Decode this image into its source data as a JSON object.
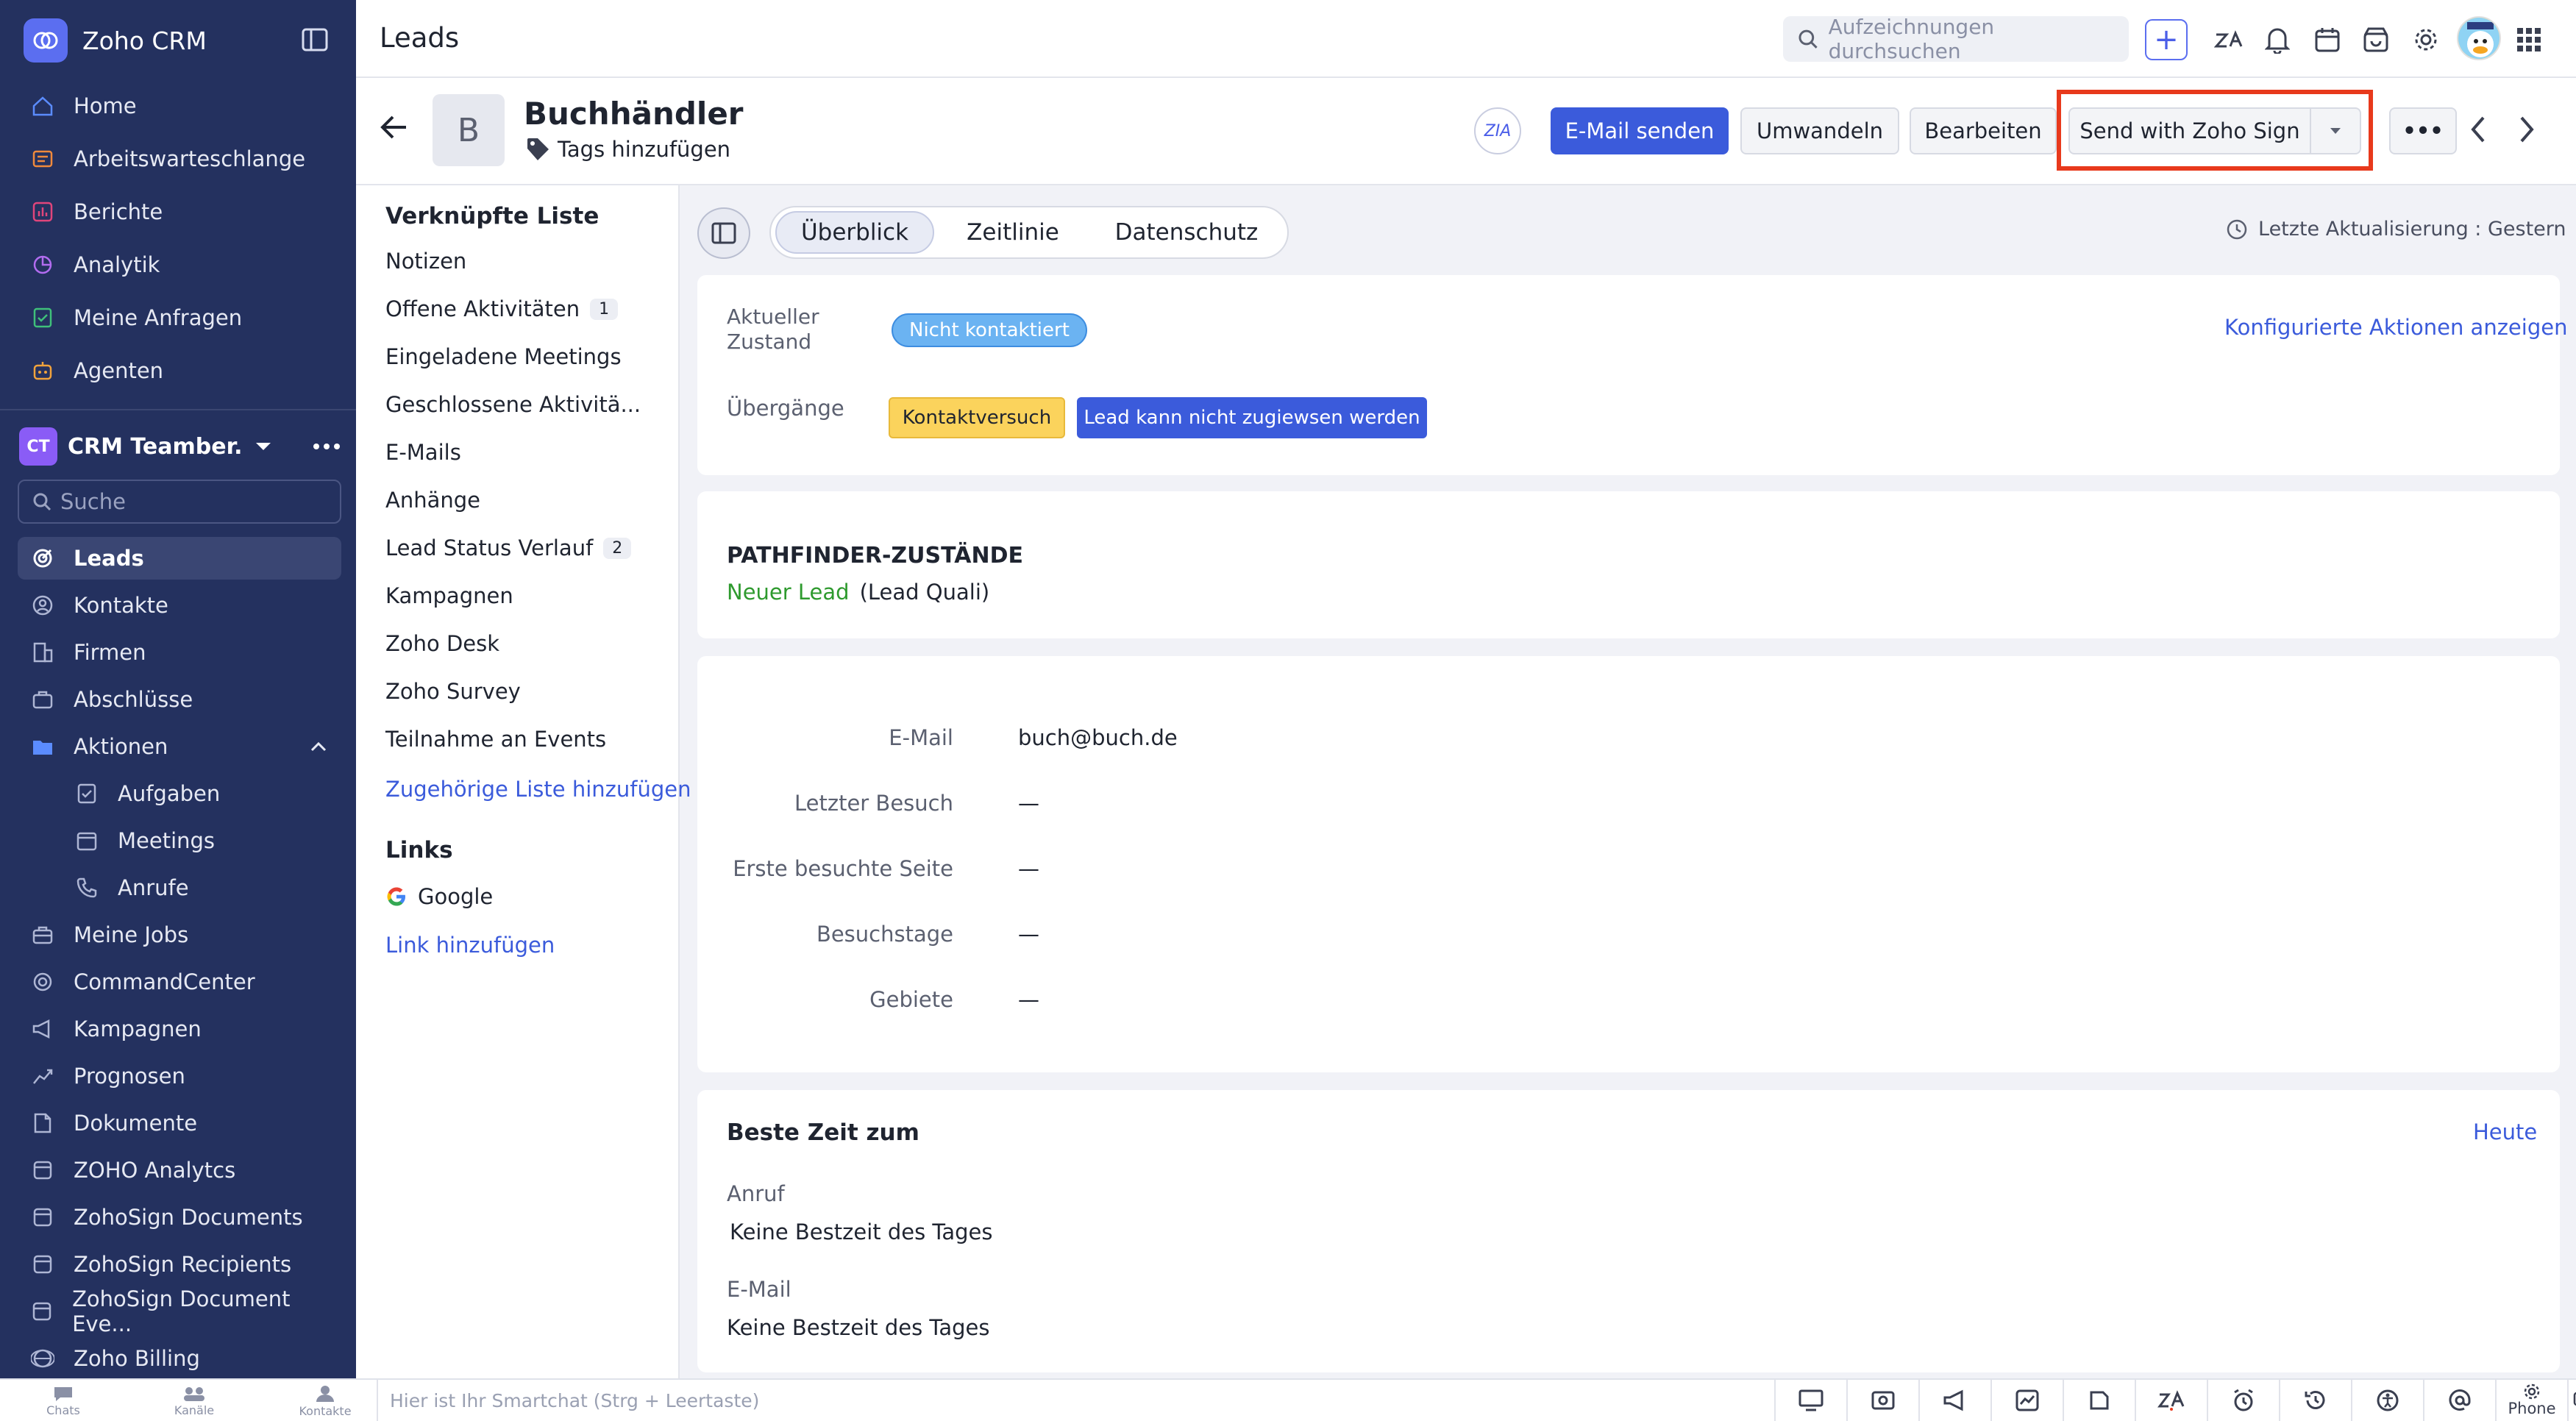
{
  "app": {
    "name": "Zoho CRM",
    "brand_color": "#5b6ef0",
    "sidebar_color": "#24315f"
  },
  "sidebar": {
    "top_items": [
      {
        "label": "Home",
        "icon": "home-icon"
      },
      {
        "label": "Arbeitswarteschlange",
        "icon": "queue-icon"
      },
      {
        "label": "Berichte",
        "icon": "reports-icon"
      },
      {
        "label": "Analytik",
        "icon": "analytics-icon"
      },
      {
        "label": "Meine Anfragen",
        "icon": "requests-icon"
      },
      {
        "label": "Agenten",
        "icon": "agent-icon"
      }
    ],
    "workspace": {
      "badge": "CT",
      "name": "CRM Teamber..."
    },
    "search_placeholder": "Suche",
    "modules": [
      {
        "label": "Leads",
        "icon": "leads-icon",
        "active": true
      },
      {
        "label": "Kontakte",
        "icon": "contacts-icon"
      },
      {
        "label": "Firmen",
        "icon": "accounts-icon"
      },
      {
        "label": "Abschlüsse",
        "icon": "deals-icon"
      },
      {
        "label": "Aktionen",
        "icon": "folder-icon",
        "expanded": true
      },
      {
        "label": "Aufgaben",
        "icon": "tasks-icon",
        "sub": true
      },
      {
        "label": "Meetings",
        "icon": "meetings-icon",
        "sub": true
      },
      {
        "label": "Anrufe",
        "icon": "calls-icon",
        "sub": true
      },
      {
        "label": "Meine Jobs",
        "icon": "jobs-icon"
      },
      {
        "label": "CommandCenter",
        "icon": "commandcenter-icon"
      },
      {
        "label": "Kampagnen",
        "icon": "campaigns-icon"
      },
      {
        "label": "Prognosen",
        "icon": "forecasts-icon"
      },
      {
        "label": "Dokumente",
        "icon": "documents-icon"
      },
      {
        "label": "ZOHO Analytcs",
        "icon": "module-icon"
      },
      {
        "label": "ZohoSign Documents",
        "icon": "module-icon"
      },
      {
        "label": "ZohoSign Recipients",
        "icon": "module-icon"
      },
      {
        "label": "ZohoSign Document Eve...",
        "icon": "module-icon"
      },
      {
        "label": "Zoho Billing",
        "icon": "billing-icon"
      }
    ]
  },
  "bottombar": {
    "apps": [
      "Chats",
      "Kanäle",
      "Kontakte"
    ],
    "smartchat_placeholder": "Hier ist Ihr Smartchat (Strg + Leertaste)",
    "phone_label": "Phone"
  },
  "topbar": {
    "title": "Leads",
    "search_placeholder": "Aufzeichnungen durchsuchen"
  },
  "record": {
    "avatar_letter": "B",
    "name": "Buchhändler",
    "tags_label": "Tags hinzufügen",
    "za_label": "ZIA",
    "buttons": {
      "send_email": "E-Mail senden",
      "convert": "Umwandeln",
      "edit": "Bearbeiten",
      "send_sign": "Send with Zoho Sign",
      "more": "•••"
    },
    "highlight_color": "#e8391c"
  },
  "related": {
    "heading": "Verknüpfte Liste",
    "items": [
      {
        "label": "Notizen"
      },
      {
        "label": "Offene Aktivitäten",
        "count": "1"
      },
      {
        "label": "Eingeladene Meetings"
      },
      {
        "label": "Geschlossene Aktivitä..."
      },
      {
        "label": "E-Mails"
      },
      {
        "label": "Anhänge"
      },
      {
        "label": "Lead Status Verlauf",
        "count": "2"
      },
      {
        "label": "Kampagnen"
      },
      {
        "label": "Zoho Desk"
      },
      {
        "label": "Zoho Survey"
      },
      {
        "label": "Teilnahme an Events"
      }
    ],
    "add_related": "Zugehörige Liste hinzufügen",
    "links_heading": "Links",
    "links": [
      {
        "label": "Google",
        "icon": "google-icon"
      }
    ],
    "add_link": "Link hinzufügen"
  },
  "tabs": {
    "items": [
      "Überblick",
      "Zeitlinie",
      "Datenschutz"
    ],
    "active": "Überblick",
    "last_update": "Letzte Aktualisierung : Gestern"
  },
  "state_card": {
    "current_label_line1": "Aktueller",
    "current_label_line2": "Zustand",
    "current_value": "Nicht kontaktiert",
    "configured_actions": "Konfigurierte Aktionen anzeigen",
    "transitions_label": "Übergänge",
    "transitions": [
      {
        "label": "Kontaktversuch",
        "bg": "#fbd35c",
        "fg": "#1f2430"
      },
      {
        "label": "Lead kann nicht zugiewsen werden",
        "bg": "#3b5bdb",
        "fg": "#ffffff"
      }
    ]
  },
  "pathfinder": {
    "heading": "PATHFINDER-ZUSTÄNDE",
    "state": "Neuer Lead",
    "detail": "(Lead Quali)"
  },
  "fields": [
    {
      "label": "E-Mail",
      "value": "buch@buch.de",
      "is_link": true
    },
    {
      "label": "Letzter Besuch",
      "value": "—"
    },
    {
      "label": "Erste besuchte Seite",
      "value": "—"
    },
    {
      "label": "Besuchstage",
      "value": "—"
    },
    {
      "label": "Gebiete",
      "value": "—"
    }
  ],
  "best_time": {
    "heading": "Beste Zeit zum",
    "today": "Heute",
    "call_label": "Anruf",
    "call_value": "Keine Bestzeit des Tages",
    "email_label": "E-Mail",
    "email_value": "Keine Bestzeit des Tages"
  }
}
